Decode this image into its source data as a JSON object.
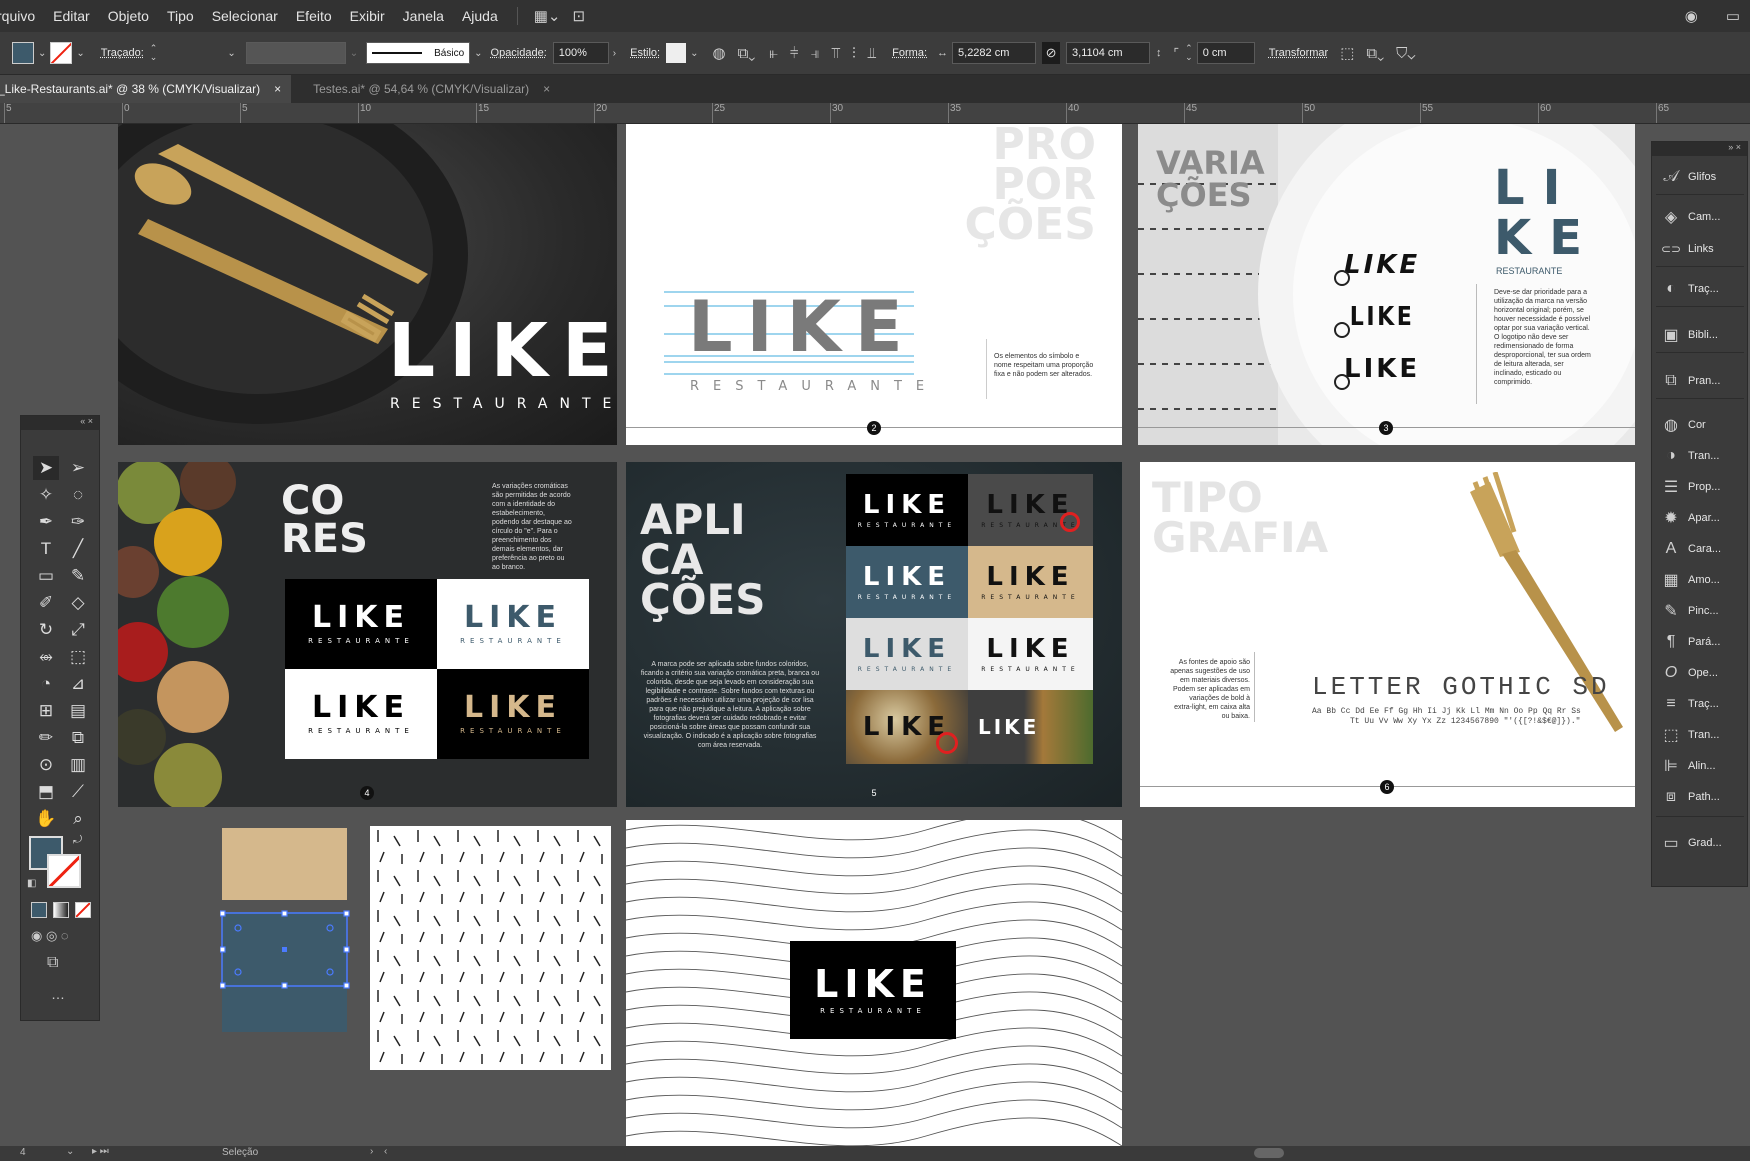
{
  "menu": [
    "rquivo",
    "Editar",
    "Objeto",
    "Tipo",
    "Selecionar",
    "Efeito",
    "Exibir",
    "Janela",
    "Ajuda"
  ],
  "control": {
    "tracado_label": "Traçado:",
    "stroke_style": "Básico",
    "opacidade_label": "Opacidade:",
    "opacidade_value": "100%",
    "estilo_label": "Estilo:",
    "forma_label": "Forma:",
    "width_value": "5,2282 cm",
    "height_value": "3,1104 cm",
    "corner_value": "0 cm",
    "transformar_label": "Transformar"
  },
  "tabs": [
    {
      "label": "_Like-Restaurants.ai* @ 38 % (CMYK/Visualizar)",
      "close": "×"
    },
    {
      "label": "Testes.ai* @ 54,64 % (CMYK/Visualizar)",
      "close": "×"
    }
  ],
  "ruler_ticks": [
    "5",
    "0",
    "5",
    "10",
    "15",
    "20",
    "25",
    "30",
    "35",
    "40",
    "45",
    "50",
    "55",
    "60",
    "65"
  ],
  "right_panel": [
    {
      "label": "Glifos",
      "icon": "glyphs-icon",
      "glyph": "𝒜"
    },
    {
      "label": "Cam...",
      "icon": "layers-icon",
      "glyph": "◈"
    },
    {
      "label": "Links",
      "icon": "links-icon",
      "glyph": "⊂⊃"
    },
    {
      "label": "Traç...",
      "icon": "trace-icon",
      "glyph": "◐"
    },
    {
      "label": "Bibli...",
      "icon": "libraries-icon",
      "glyph": "▣"
    },
    {
      "label": "Pran...",
      "icon": "artboards-icon",
      "glyph": "⧉"
    },
    {
      "label": "Cor",
      "icon": "color-icon",
      "glyph": "◍"
    },
    {
      "label": "Tran...",
      "icon": "transparency-icon",
      "glyph": "◑"
    },
    {
      "label": "Prop...",
      "icon": "properties-icon",
      "glyph": "☰"
    },
    {
      "label": "Apar...",
      "icon": "appearance-icon",
      "glyph": "✹"
    },
    {
      "label": "Cara...",
      "icon": "character-icon",
      "glyph": "A"
    },
    {
      "label": "Amo...",
      "icon": "swatches-icon",
      "glyph": "▦"
    },
    {
      "label": "Pinc...",
      "icon": "brushes-icon",
      "glyph": "✎"
    },
    {
      "label": "Pará...",
      "icon": "paragraph-icon",
      "glyph": "¶"
    },
    {
      "label": "Ope...",
      "icon": "opentype-icon",
      "glyph": "O"
    },
    {
      "label": "Traç...",
      "icon": "stroke-icon",
      "glyph": "≡"
    },
    {
      "label": "Tran...",
      "icon": "transform-icon",
      "glyph": "⬚"
    },
    {
      "label": "Alin...",
      "icon": "align-icon",
      "glyph": "⊫"
    },
    {
      "label": "Path...",
      "icon": "pathfinder-icon",
      "glyph": "⧈"
    },
    {
      "label": "Grad...",
      "icon": "gradient-icon",
      "glyph": "▭"
    }
  ],
  "status": {
    "zoom": "4",
    "tool": "Seleção"
  },
  "artboards": {
    "cover": {
      "logo": "LIKE",
      "sub": "RESTAURANTE"
    },
    "proporcoes": {
      "title": [
        "PRO",
        "POR",
        "ÇÕES"
      ],
      "logo": "LIKE",
      "sub": "RESTAURANTE",
      "text": "Os elementos do símbolo e nome respeitam uma proporção fixa e não podem ser alterados.",
      "page": "2"
    },
    "variacoes": {
      "title": [
        "VARIA",
        "ÇÕES"
      ],
      "vert_logo": [
        "LI",
        "KE"
      ],
      "vert_sub": "RESTAURANTE",
      "small_logo": "LIKE",
      "small_sub": "RESTAURANTE",
      "text": "Deve-se dar prioridade para a utilização da marca na versão horizontal original; porém, se houver necessidade é possível optar por sua variação vertical. O logotipo não deve ser redimensionado de forma desproporcional, ter sua ordem de leitura alterada, ser inclinado, esticado ou comprimido.",
      "page": "3"
    },
    "cores": {
      "title": [
        "CO",
        "RES"
      ],
      "text": "As variações cromáticas são permitidas de acordo com a identidade do estabelecimento, podendo dar destaque ao círculo do \"e\". Para o preenchimento dos demais elementos, dar preferência ao preto ou ao branco.",
      "logo": "LIKE",
      "sub": "RESTAURANTE",
      "page": "4"
    },
    "aplicacoes": {
      "title": [
        "APLI",
        "CA",
        "ÇÕES"
      ],
      "text": "A marca pode ser aplicada sobre fundos coloridos, ficando a critério sua variação cromática preta, branca ou colorida, desde que seja levado em consideração sua legibilidade e contraste. Sobre fundos com texturas ou padrões é necessário utilizar uma projeção de cor lisa para que não prejudique a leitura. A aplicação sobre fotografias deverá ser cuidado redobrado e evitar posicioná-la sobre áreas que possam confundir sua visualização. O indicado é a aplicação sobre fotografias com área reservada.",
      "logo": "LIKE",
      "sub": "RESTAURANTE",
      "page": "5"
    },
    "tipografia": {
      "title": [
        "TIPO",
        "GRAFIA"
      ],
      "text": "As fontes de apoio são apenas sugestões de uso em materiais diversos. Podem ser aplicadas em variações de bold à extra-light, em caixa alta ou baixa.",
      "font_name": "LETTER GOTHIC SD",
      "alphabet_1": "Aa Bb Cc Dd Ee Ff Gg Hh Ii Jj Kk Ll Mm Nn Oo Pp Qq Rr Ss",
      "alphabet_2": "Tt Uu Vv Ww Xy Yx Zz 1234567890 \"'({[?!&$€@]}).\"",
      "page": "6"
    },
    "pattern_logo": {
      "logo": "LIKE",
      "sub": "RESTAURANTE"
    }
  },
  "colors": {
    "accent": "#3d5a6b",
    "beige": "#d5b88c",
    "dark": "#111111",
    "gold": "#c8a35a"
  }
}
